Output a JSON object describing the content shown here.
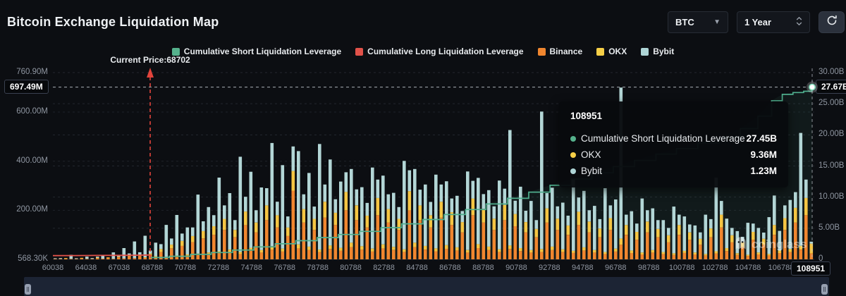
{
  "header": {
    "title": "Bitcoin Exchange Liquidation Map",
    "coin_select": {
      "value": "BTC"
    },
    "timeframe_select": {
      "value": "1 Year"
    }
  },
  "legend": {
    "items": [
      {
        "label": "Cumulative Short Liquidation Leverage",
        "color": "#55b18c"
      },
      {
        "label": "Cumulative Long Liquidation Leverage",
        "color": "#e1524a"
      },
      {
        "label": "Binance",
        "color": "#f0862f"
      },
      {
        "label": "OKX",
        "color": "#f6cf47"
      },
      {
        "label": "Bybit",
        "color": "#aed5d6"
      }
    ]
  },
  "annotations": {
    "current_price_label": "Current Price:68702",
    "left_value_label": "697.49M",
    "right_value_label": "27.67B",
    "x_value_label": "108951"
  },
  "tooltip": {
    "title": "108951",
    "rows": [
      {
        "label": "Cumulative Short Liquidation Leverage",
        "value": "27.45B",
        "color": "#55b18c"
      },
      {
        "label": "OKX",
        "value": "9.36M",
        "color": "#f6cf47"
      },
      {
        "label": "Bybit",
        "value": "1.23M",
        "color": "#aed5d6"
      }
    ]
  },
  "watermark": {
    "text": "coinglass"
  },
  "chart_data": {
    "type": "bar",
    "title": "Bitcoin Exchange Liquidation Map",
    "x_axis": {
      "labels": [
        "60038",
        "64038",
        "67038",
        "68788",
        "70788",
        "72788",
        "74788",
        "76788",
        "78788",
        "80788",
        "82788",
        "84788",
        "86788",
        "88788",
        "90788",
        "92788",
        "94788",
        "96788",
        "98788",
        "100788",
        "102788",
        "104788",
        "106788",
        "108951"
      ]
    },
    "left_axis": {
      "unit": "M",
      "max_M": 760.9,
      "ticks": [
        {
          "label": "760.90M",
          "v": 760.9
        },
        {
          "label": "600.00M",
          "v": 600
        },
        {
          "label": "400.00M",
          "v": 400
        },
        {
          "label": "200.00M",
          "v": 200
        },
        {
          "label": "568.30K",
          "v": 0.5683
        }
      ],
      "grid_M": [
        600,
        400,
        200
      ]
    },
    "right_axis": {
      "unit": "B",
      "max_B": 30,
      "ticks": [
        {
          "label": "30.00B",
          "v": 30
        },
        {
          "label": "25.00B",
          "v": 25
        },
        {
          "label": "20.00B",
          "v": 20
        },
        {
          "label": "15.00B",
          "v": 15
        },
        {
          "label": "10.00B",
          "v": 10
        },
        {
          "label": "5.00B",
          "v": 5
        },
        {
          "label": "0",
          "v": 0
        }
      ],
      "grid_B": [
        30,
        25,
        20,
        15,
        10,
        5
      ]
    },
    "colors": {
      "short_line": "#4fae8d",
      "long_line": "#e1524a",
      "binance": "#f0862f",
      "okx": "#f5c543",
      "bybit": "#b3d6d6",
      "current_price": "#e2443c"
    },
    "current_price": {
      "value": 68702,
      "x_fraction": 0.1278
    },
    "short_latest_B": 27.67,
    "long_latest_label": "697.49M",
    "highlight_point": {
      "x": "108951",
      "short_B": 27.45,
      "okx_M": 9.36,
      "bybit_M": 1.23
    },
    "short_line_points": [
      [
        0.128,
        0.3
      ],
      [
        0.153,
        0.5
      ],
      [
        0.181,
        0.8
      ],
      [
        0.208,
        1.1
      ],
      [
        0.236,
        1.5
      ],
      [
        0.264,
        2.0
      ],
      [
        0.292,
        2.5
      ],
      [
        0.319,
        3.0
      ],
      [
        0.347,
        3.5
      ],
      [
        0.375,
        4.0
      ],
      [
        0.403,
        4.5
      ],
      [
        0.431,
        5.1
      ],
      [
        0.458,
        5.7
      ],
      [
        0.486,
        6.4
      ],
      [
        0.514,
        7.2
      ],
      [
        0.542,
        8.0
      ],
      [
        0.569,
        8.9
      ],
      [
        0.597,
        9.8
      ],
      [
        0.625,
        10.8
      ],
      [
        0.653,
        11.9
      ],
      [
        0.681,
        12.9
      ],
      [
        0.708,
        13.9
      ],
      [
        0.736,
        14.9
      ],
      [
        0.764,
        15.9
      ],
      [
        0.792,
        16.9
      ],
      [
        0.819,
        17.8
      ],
      [
        0.847,
        18.7
      ],
      [
        0.875,
        19.6
      ],
      [
        0.903,
        21.0
      ],
      [
        0.926,
        23.0
      ],
      [
        0.944,
        25.5
      ],
      [
        0.958,
        26.5
      ],
      [
        0.972,
        26.8
      ],
      [
        0.986,
        27.0
      ],
      [
        0.997,
        27.67
      ]
    ],
    "long_line_points": [
      [
        0.0,
        0.6
      ],
      [
        0.03,
        0.61
      ],
      [
        0.06,
        0.63
      ],
      [
        0.09,
        0.65
      ],
      [
        0.11,
        0.67
      ],
      [
        0.128,
        0.697
      ]
    ],
    "bars_M_binance_okx_bybit": [
      [
        2,
        0,
        1
      ],
      [
        1,
        0,
        3
      ],
      [
        3,
        1,
        0
      ],
      [
        1,
        0,
        16
      ],
      [
        2,
        0,
        2
      ],
      [
        4,
        1,
        0
      ],
      [
        1,
        0,
        9
      ],
      [
        2,
        0,
        3
      ],
      [
        5,
        2,
        4
      ],
      [
        3,
        0,
        12
      ],
      [
        6,
        2,
        0
      ],
      [
        2,
        0,
        26
      ],
      [
        8,
        3,
        6
      ],
      [
        4,
        0,
        42
      ],
      [
        12,
        4,
        8
      ],
      [
        5,
        0,
        68
      ],
      [
        14,
        5,
        10
      ],
      [
        6,
        2,
        88
      ],
      [
        18,
        6,
        12
      ],
      [
        10,
        3,
        55
      ],
      [
        30,
        12,
        20
      ],
      [
        8,
        2,
        130
      ],
      [
        45,
        15,
        25
      ],
      [
        12,
        4,
        165
      ],
      [
        55,
        20,
        30
      ],
      [
        15,
        5,
        110
      ],
      [
        70,
        25,
        35
      ],
      [
        18,
        6,
        240
      ],
      [
        85,
        30,
        40
      ],
      [
        20,
        8,
        185
      ],
      [
        100,
        35,
        45
      ],
      [
        25,
        8,
        300
      ],
      [
        120,
        45,
        55
      ],
      [
        30,
        10,
        230
      ],
      [
        90,
        30,
        40
      ],
      [
        22,
        8,
        388
      ],
      [
        140,
        55,
        60
      ],
      [
        35,
        12,
        310
      ],
      [
        110,
        40,
        50
      ],
      [
        28,
        10,
        255
      ],
      [
        160,
        60,
        70
      ],
      [
        40,
        14,
        420
      ],
      [
        130,
        50,
        55
      ],
      [
        32,
        12,
        340
      ],
      [
        95,
        35,
        45
      ],
      [
        280,
        80,
        100
      ],
      [
        45,
        16,
        380
      ],
      [
        150,
        55,
        60
      ],
      [
        38,
        14,
        300
      ],
      [
        120,
        45,
        50
      ],
      [
        30,
        10,
        430
      ],
      [
        170,
        65,
        70
      ],
      [
        42,
        15,
        350
      ],
      [
        140,
        50,
        55
      ],
      [
        35,
        12,
        270
      ],
      [
        200,
        75,
        80
      ],
      [
        50,
        18,
        300
      ],
      [
        160,
        60,
        65
      ],
      [
        40,
        14,
        240
      ],
      [
        130,
        48,
        52
      ],
      [
        32,
        12,
        330
      ],
      [
        180,
        70,
        75
      ],
      [
        45,
        16,
        280
      ],
      [
        150,
        55,
        60
      ],
      [
        38,
        13,
        220
      ],
      [
        120,
        45,
        48
      ],
      [
        30,
        11,
        360
      ],
      [
        200,
        78,
        85
      ],
      [
        50,
        18,
        300
      ],
      [
        160,
        60,
        64
      ],
      [
        40,
        15,
        250
      ],
      [
        130,
        50,
        54
      ],
      [
        33,
        12,
        300
      ],
      [
        170,
        65,
        70
      ],
      [
        43,
        15,
        260
      ],
      [
        140,
        52,
        56
      ],
      [
        36,
        13,
        210
      ],
      [
        110,
        42,
        45
      ],
      [
        28,
        10,
        320
      ],
      [
        180,
        68,
        72
      ],
      [
        46,
        16,
        270
      ],
      [
        150,
        56,
        60
      ],
      [
        38,
        14,
        230
      ],
      [
        120,
        46,
        50
      ],
      [
        30,
        11,
        280
      ],
      [
        160,
        62,
        66
      ],
      [
        42,
        15,
        470
      ],
      [
        135,
        50,
        54
      ],
      [
        34,
        12,
        250
      ],
      [
        110,
        42,
        46
      ],
      [
        28,
        10,
        200
      ],
      [
        90,
        34,
        36
      ],
      [
        30,
        12,
        560
      ],
      [
        150,
        58,
        62
      ],
      [
        38,
        14,
        240
      ],
      [
        120,
        46,
        50
      ],
      [
        30,
        11,
        190
      ],
      [
        100,
        38,
        40
      ],
      [
        26,
        9,
        290
      ],
      [
        140,
        54,
        58
      ],
      [
        36,
        13,
        230
      ],
      [
        110,
        44,
        46
      ],
      [
        28,
        10,
        180
      ],
      [
        90,
        36,
        38
      ],
      [
        22,
        8,
        260
      ],
      [
        120,
        48,
        52
      ],
      [
        32,
        12,
        200
      ],
      [
        60,
        25,
        615
      ],
      [
        100,
        40,
        42
      ],
      [
        26,
        10,
        160
      ],
      [
        80,
        32,
        34
      ],
      [
        20,
        8,
        220
      ],
      [
        110,
        44,
        46
      ],
      [
        28,
        10,
        170
      ],
      [
        90,
        34,
        36
      ],
      [
        22,
        8,
        130
      ],
      [
        70,
        28,
        30
      ],
      [
        18,
        7,
        190
      ],
      [
        100,
        40,
        42
      ],
      [
        26,
        9,
        140
      ],
      [
        80,
        30,
        32
      ],
      [
        20,
        8,
        110
      ],
      [
        60,
        24,
        26
      ],
      [
        16,
        6,
        160
      ],
      [
        90,
        36,
        38
      ],
      [
        24,
        9,
        300
      ],
      [
        130,
        52,
        56
      ],
      [
        34,
        12,
        120
      ],
      [
        70,
        28,
        30
      ],
      [
        18,
        7,
        90
      ],
      [
        50,
        20,
        22
      ],
      [
        14,
        5,
        130
      ],
      [
        80,
        32,
        34
      ],
      [
        20,
        8,
        100
      ],
      [
        60,
        24,
        25
      ],
      [
        16,
        6,
        150
      ],
      [
        100,
        40,
        120
      ],
      [
        26,
        10,
        80
      ],
      [
        120,
        48,
        52
      ],
      [
        30,
        12,
        200
      ],
      [
        150,
        60,
        64
      ],
      [
        40,
        15,
        460
      ],
      [
        180,
        70,
        75
      ],
      [
        24,
        40,
        8
      ]
    ]
  }
}
